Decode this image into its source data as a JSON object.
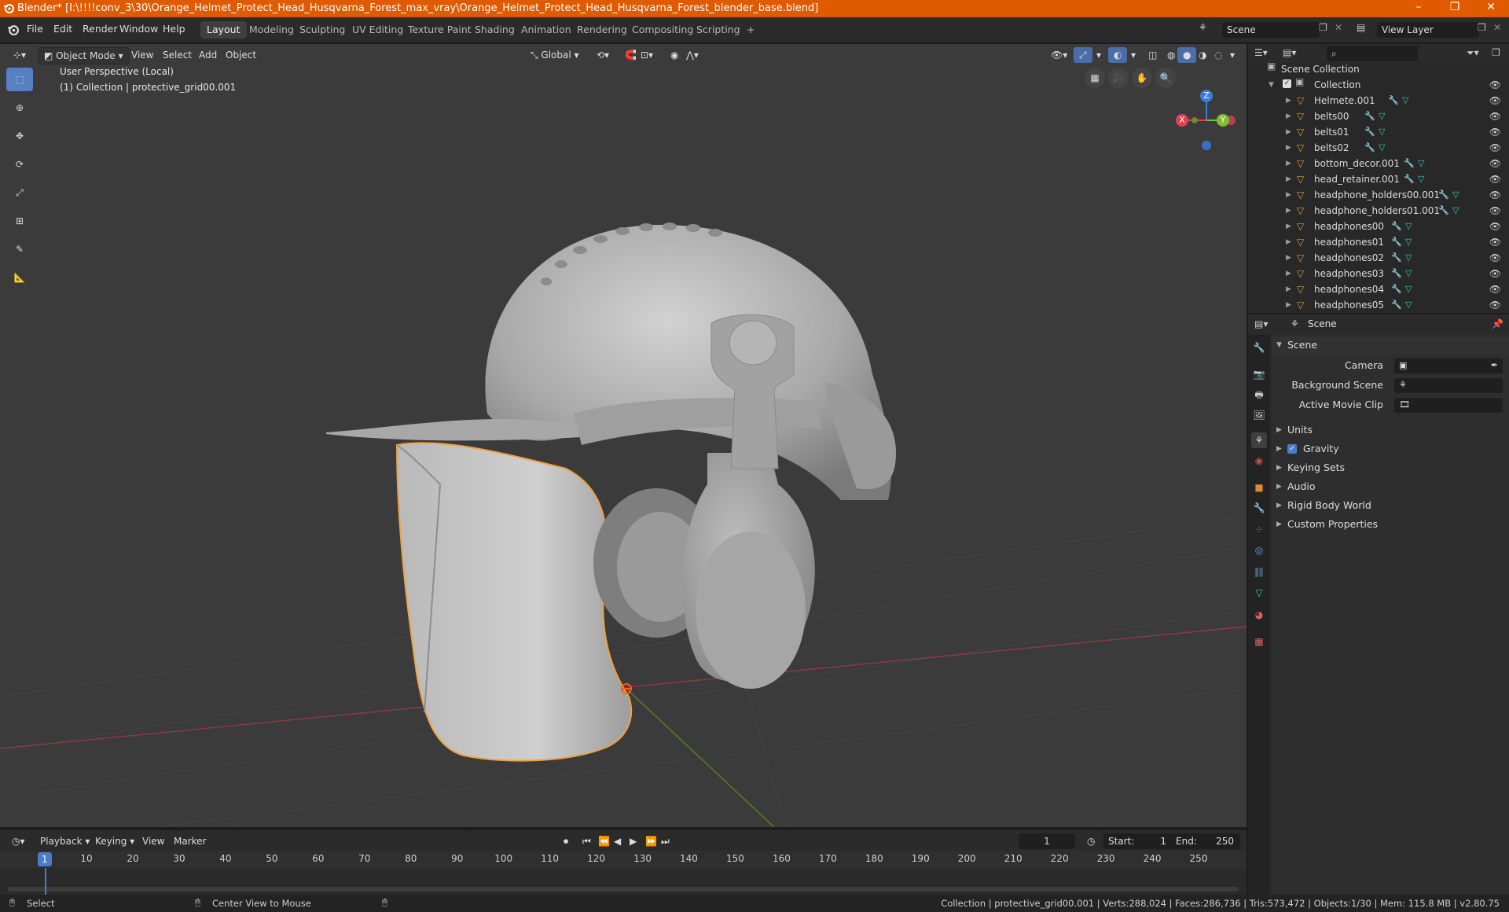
{
  "window": {
    "title": "Blender* [I:\\!!!!conv_3\\30\\Orange_Helmet_Protect_Head_Husqvarna_Forest_max_vray\\Orange_Helmet_Protect_Head_Husqvarna_Forest_blender_base.blend]",
    "controls": [
      "–",
      "❐",
      "✕"
    ]
  },
  "menu": [
    "File",
    "Edit",
    "Render",
    "Window",
    "Help"
  ],
  "workspaces": [
    "Layout",
    "Modeling",
    "Sculpting",
    "UV Editing",
    "Texture Paint",
    "Shading",
    "Animation",
    "Rendering",
    "Compositing",
    "Scripting"
  ],
  "workspace_add": "+",
  "scene_field": "Scene",
  "view_layer_field": "View Layer",
  "viewport": {
    "mode": "Object Mode",
    "menus": [
      "View",
      "Select",
      "Add",
      "Object"
    ],
    "orientation": "Global",
    "info_line1": "User Perspective (Local)",
    "info_line2": "(1) Collection | protective_grid00.001",
    "gizmo": {
      "x": "X",
      "y": "Y",
      "z": "Z"
    }
  },
  "outliner": {
    "search_placeholder": "",
    "root": "Scene Collection",
    "collection": "Collection",
    "objects": [
      "Helmete.001",
      "belts00",
      "belts01",
      "belts02",
      "bottom_decor.001",
      "head_retainer.001",
      "headphone_holders00.001",
      "headphone_holders01.001",
      "headphones00",
      "headphones01",
      "headphones02",
      "headphones03",
      "headphones04",
      "headphones05"
    ]
  },
  "properties": {
    "context": "Scene",
    "panel": "Scene",
    "fields": [
      {
        "label": "Camera",
        "value": ""
      },
      {
        "label": "Background Scene",
        "value": ""
      },
      {
        "label": "Active Movie Clip",
        "value": ""
      }
    ],
    "subpanels": [
      "Units",
      "Gravity",
      "Keying Sets",
      "Audio",
      "Rigid Body World",
      "Custom Properties"
    ],
    "gravity_checked": true
  },
  "timeline": {
    "menus": [
      "Playback",
      "Keying",
      "View",
      "Marker"
    ],
    "current_frame": "1",
    "start_label": "Start:",
    "start": "1",
    "end_label": "End:",
    "end": "250",
    "ticks": [
      "1",
      "10",
      "20",
      "30",
      "40",
      "50",
      "60",
      "70",
      "80",
      "90",
      "100",
      "110",
      "120",
      "130",
      "140",
      "150",
      "160",
      "170",
      "180",
      "190",
      "200",
      "210",
      "220",
      "230",
      "240",
      "250"
    ]
  },
  "statusbar": {
    "left": "Select",
    "middle": "Center View to Mouse",
    "right": "Collection | protective_grid00.001 | Verts:288,024 | Faces:286,736 | Tris:573,472 | Objects:1/30 | Mem: 115.8 MB | v2.80.75"
  },
  "colors": {
    "title_bar": "#e05a00",
    "accent": "#5680c2",
    "selection_outline": "#f0a040",
    "x_axis": "#e04050",
    "y_axis": "#80c030",
    "z_axis": "#3c7ce0"
  }
}
